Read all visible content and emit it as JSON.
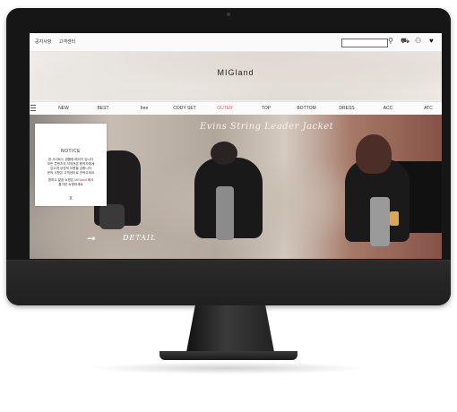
{
  "topbar": {
    "links": [
      "공지사항",
      "고객센터"
    ],
    "search_placeholder": "",
    "icons": [
      "search-icon",
      "cart-icon",
      "user-icon",
      "heart-icon"
    ]
  },
  "brand": {
    "logo": "MIGland"
  },
  "nav": {
    "items": [
      "NEW",
      "BEST",
      "free",
      "CODY SET",
      "OUTER",
      "TOP",
      "BOTTOM",
      "DRESS",
      "ACC",
      "ATC"
    ],
    "active_index": 4,
    "active_color": "#e0605a"
  },
  "banner": {
    "title": "Evins String Leader Jacket",
    "detail_label": "DETAIL"
  },
  "notice": {
    "title": "NOTICE",
    "lines": [
      "현 사이트는 샘플링 페이지 입니다",
      "모든 콘텐츠의 저작권은 원작자에게",
      "있으며 상업적 이용을 금합니다",
      "문의 사항은 고객센터로 연락주세요"
    ],
    "line_pre": "편하고 깔끔 쇼핑은",
    "line_highlight": "MIGland",
    "line_post": "에서",
    "line_end": "즐거운 쇼핑하세요",
    "close_label": "X"
  }
}
